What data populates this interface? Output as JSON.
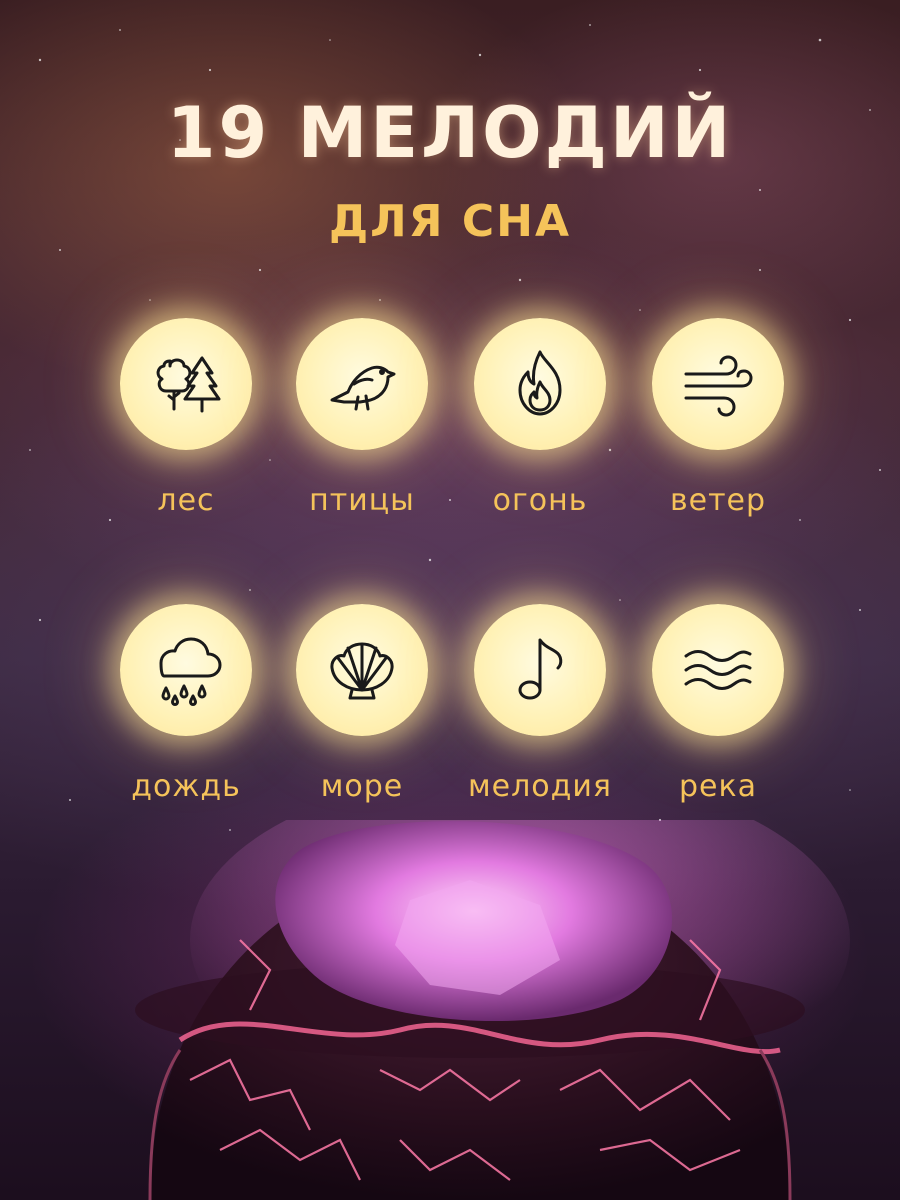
{
  "headline": {
    "title": "19 МЕЛОДИЙ",
    "subtitle": "ДЛЯ СНА"
  },
  "sounds": [
    {
      "label": "лес",
      "icon": "forest-icon"
    },
    {
      "label": "птицы",
      "icon": "bird-icon"
    },
    {
      "label": "огонь",
      "icon": "fire-icon"
    },
    {
      "label": "ветер",
      "icon": "wind-icon"
    },
    {
      "label": "дождь",
      "icon": "rain-cloud-icon"
    },
    {
      "label": "море",
      "icon": "seashell-icon"
    },
    {
      "label": "мелодия",
      "icon": "music-note-icon"
    },
    {
      "label": "река",
      "icon": "waves-icon"
    }
  ],
  "colors": {
    "title": "#fff1dc",
    "accent": "#f5c35a",
    "icon_circle": "#fff2b8",
    "icon_stroke": "#1a1a1a",
    "lamp_glow": "#e07ad8"
  }
}
